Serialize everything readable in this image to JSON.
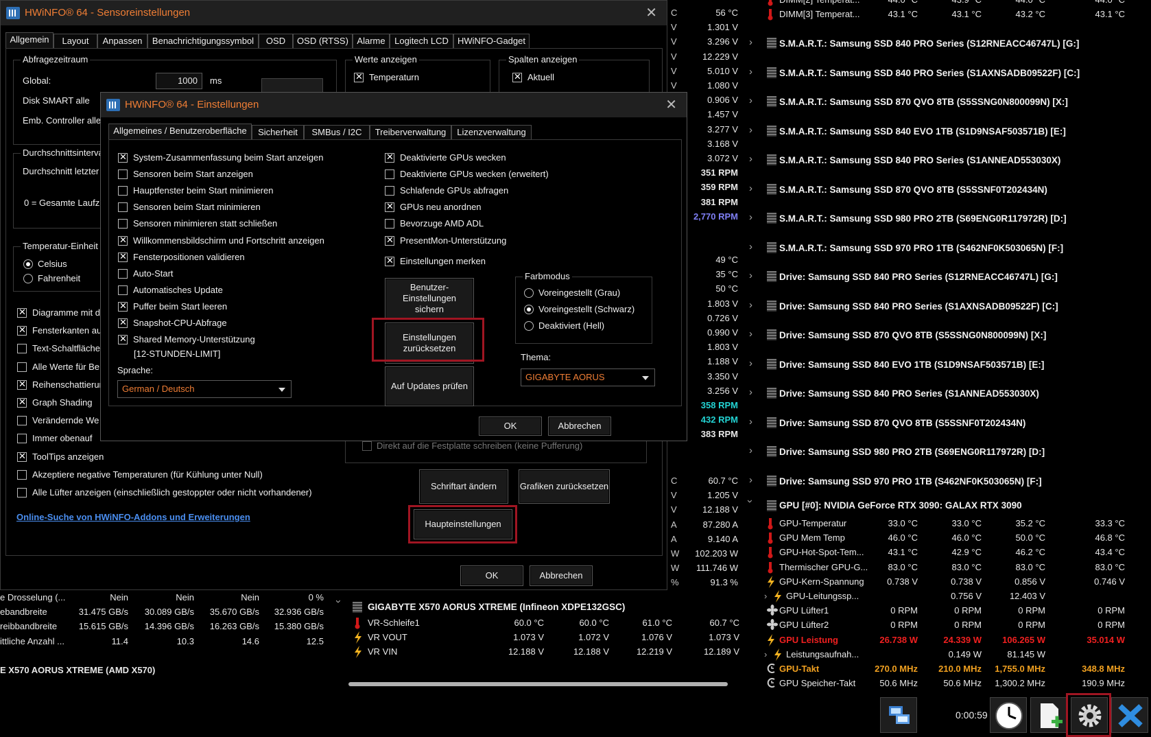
{
  "middle_values": {
    "top": [
      "56 °C",
      "1.301 V",
      "3.296 V",
      "12.229 V",
      "5.010 V",
      "1.080 V",
      "0.906 V",
      "1.457 V",
      "3.277 V",
      "3.168 V",
      "3.072 V"
    ],
    "rpm": [
      "351 RPM",
      "359 RPM",
      "381 RPM",
      "2,770 RPM"
    ],
    "temps": [
      "49 °C",
      "35 °C",
      "50 °C"
    ],
    "volts": [
      "1.803 V",
      "0.726 V",
      "0.990 V",
      "1.803 V",
      "1.188 V",
      "3.350 V",
      "3.256 V"
    ],
    "rpm2": [
      "358 RPM",
      "432 RPM",
      "383 RPM"
    ],
    "lower": [
      "60.7 °C",
      "1.205 V",
      "12.188 V",
      "87.280 A",
      "9.140 A",
      "102.203 W",
      "111.746 W",
      "91.3 %"
    ],
    "lower_units": [
      "C",
      "V",
      "V",
      "A",
      "A",
      "W",
      "W",
      "%"
    ],
    "top_units": [
      "C",
      "V",
      "V",
      "V",
      "V",
      "V",
      "V",
      "V",
      "V",
      "V",
      "V"
    ]
  },
  "right_panel": {
    "top_rows": [
      {
        "label": "DIMM[2] Temperat...",
        "v": [
          "44.0 °C",
          "43.9 °C",
          "44.0 °C",
          "44.0 °C"
        ]
      },
      {
        "label": "DIMM[3] Temperat...",
        "v": [
          "43.1 °C",
          "43.1 °C",
          "43.2 °C",
          "43.1 °C"
        ]
      }
    ],
    "devices": [
      "S.M.A.R.T.: Samsung SSD 840 PRO Series (S12RNEACC46747L) [G:]",
      "S.M.A.R.T.: Samsung SSD 840 PRO Series (S1AXNSADB09522F) [C:]",
      "S.M.A.R.T.: Samsung SSD 870 QVO 8TB (S5SSNG0N800099N) [X:]",
      "S.M.A.R.T.: Samsung SSD 840 EVO 1TB (S1D9NSAF503571B) [E:]",
      "S.M.A.R.T.: Samsung SSD 840 PRO Series (S1ANNEAD553030X)",
      "S.M.A.R.T.: Samsung SSD 870 QVO 8TB (S5SSNF0T202434N)",
      "S.M.A.R.T.: Samsung SSD 980 PRO 2TB (S69ENG0R117972R) [D:]",
      "S.M.A.R.T.: Samsung SSD 970 PRO 1TB (S462NF0K503065N) [F:]",
      "Drive: Samsung SSD 840 PRO Series (S12RNEACC46747L) [G:]",
      "Drive: Samsung SSD 840 PRO Series (S1AXNSADB09522F) [C:]",
      "Drive: Samsung SSD 870 QVO 8TB (S5SSNG0N800099N) [X:]",
      "Drive: Samsung SSD 840 EVO 1TB (S1D9NSAF503571B) [E:]",
      "Drive: Samsung SSD 840 PRO Series (S1ANNEAD553030X)",
      "Drive: Samsung SSD 870 QVO 8TB (S5SSNF0T202434N)",
      "Drive: Samsung SSD 980 PRO 2TB (S69ENG0R117972R) [D:]",
      "Drive: Samsung SSD 970 PRO 1TB (S462NF0K503065N) [F:]"
    ],
    "gpu_header": "GPU [#0]: NVIDIA GeForce RTX 3090: GALAX RTX 3090",
    "gpu_rows": [
      {
        "label": "GPU-Temperatur",
        "v": [
          "33.0 °C",
          "33.0 °C",
          "35.2 °C",
          "33.3 °C"
        ],
        "icon": "therm",
        "style": ""
      },
      {
        "label": "GPU Mem Temp",
        "v": [
          "46.0 °C",
          "46.0 °C",
          "50.0 °C",
          "46.8 °C"
        ],
        "icon": "therm",
        "style": ""
      },
      {
        "label": "GPU-Hot-Spot-Tem...",
        "v": [
          "43.1 °C",
          "42.9 °C",
          "46.2 °C",
          "43.4 °C"
        ],
        "icon": "therm",
        "style": ""
      },
      {
        "label": "Thermischer GPU-G...",
        "v": [
          "83.0 °C",
          "83.0 °C",
          "83.0 °C",
          "83.0 °C"
        ],
        "icon": "therm",
        "style": ""
      },
      {
        "label": "GPU-Kern-Spannung",
        "v": [
          "0.738 V",
          "0.738 V",
          "0.856 V",
          "0.746 V"
        ],
        "icon": "bolt",
        "style": ""
      },
      {
        "label": "GPU-Leitungssp...",
        "v": [
          "",
          "0.756 V",
          "12.403 V",
          ""
        ],
        "icon": "bolt",
        "style": "sub"
      },
      {
        "label": "GPU Lüfter1",
        "v": [
          "0 RPM",
          "0 RPM",
          "0 RPM",
          "0 RPM"
        ],
        "icon": "fan",
        "style": ""
      },
      {
        "label": "GPU Lüfter2",
        "v": [
          "0 RPM",
          "0 RPM",
          "0 RPM",
          "0 RPM"
        ],
        "icon": "fan",
        "style": ""
      },
      {
        "label": "GPU Leistung",
        "v": [
          "26.738 W",
          "24.339 W",
          "106.265 W",
          "35.014 W"
        ],
        "icon": "bolt",
        "style": "red"
      },
      {
        "label": "Leistungsaufnah...",
        "v": [
          "",
          "0.149 W",
          "81.145 W",
          ""
        ],
        "icon": "bolt",
        "style": "sub"
      },
      {
        "label": "GPU-Takt",
        "v": [
          "270.0 MHz",
          "210.0 MHz",
          "1,755.0 MHz",
          "348.8 MHz"
        ],
        "icon": "clock",
        "style": "orange"
      },
      {
        "label": "GPU Speicher-Takt",
        "v": [
          "50.6 MHz",
          "50.6 MHz",
          "1,300.2 MHz",
          "190.9 MHz"
        ],
        "icon": "clock",
        "style": ""
      }
    ]
  },
  "bottom_left": {
    "rows": [
      {
        "label": "e Drosselung (...",
        "v": [
          "Nein",
          "Nein",
          "Nein",
          "0 %"
        ]
      },
      {
        "label": "ebandbreite",
        "v": [
          "31.475 GB/s",
          "30.089 GB/s",
          "35.670 GB/s",
          "32.936 GB/s"
        ]
      },
      {
        "label": "reibbandbreite",
        "v": [
          "15.615 GB/s",
          "14.396 GB/s",
          "16.263 GB/s",
          "15.380 GB/s"
        ]
      },
      {
        "label": "ittliche Anzahl ...",
        "v": [
          "11.4",
          "10.3",
          "14.6",
          "12.5"
        ]
      }
    ],
    "header2": "E X570 AORUS XTREME (AMD X570)"
  },
  "bottom_mid": {
    "header": "GIGABYTE X570 AORUS XTREME (Infineon XDPE132GSC)",
    "rows": [
      {
        "label": "VR-Schleife1",
        "v": [
          "60.0 °C",
          "60.0 °C",
          "61.0 °C",
          "60.7 °C"
        ],
        "icon": "therm"
      },
      {
        "label": "VR VOUT",
        "v": [
          "1.073 V",
          "1.072 V",
          "1.076 V",
          "1.073 V"
        ],
        "icon": "bolt"
      },
      {
        "label": "VR VIN",
        "v": [
          "12.188 V",
          "12.188 V",
          "12.219 V",
          "12.189 V"
        ],
        "icon": "bolt"
      }
    ]
  },
  "taskbar": {
    "time": "0:00:59"
  },
  "sensor_settings": {
    "title": "HWiNFO® 64 - Sensoreinstellungen",
    "tabs": [
      "Allgemein",
      "Layout",
      "Anpassen",
      "Benachrichtigungssymbol",
      "OSD",
      "OSD (RTSS)",
      "Alarme",
      "Logitech LCD",
      "HWiNFO-Gadget"
    ],
    "poll_group": "Abfragezeitraum",
    "global_label": "Global:",
    "global_value": "1000",
    "ms": "ms",
    "disk_smart": "Disk SMART alle",
    "emb_ctrl": "Emb. Controller alle",
    "avg_group": "Durchschnittsinterva",
    "avg_label": "Durchschnitt letzter",
    "avg_note": "0 = Gesamte Laufz",
    "temp_group": "Temperatur-Einheit",
    "celsius": "Celsius",
    "fahrenheit": "Fahrenheit",
    "values_group": "Werte anzeigen",
    "temp_cb": "Temperaturn",
    "cols_group": "Spalten anzeigen",
    "current_cb": "Aktuell",
    "options": [
      {
        "label": "Diagramme mit d",
        "on": true
      },
      {
        "label": "Fensterkanten au",
        "on": true
      },
      {
        "label": "Text-Schaltfläche",
        "on": false
      },
      {
        "label": "Alle Werte für Be",
        "on": false
      },
      {
        "label": "Reihenschattierun",
        "on": true
      },
      {
        "label": "Graph Shading",
        "on": true
      },
      {
        "label": "Verändernde We",
        "on": false
      },
      {
        "label": "Immer obenauf",
        "on": false
      },
      {
        "label": "ToolTips anzeigen",
        "on": true
      },
      {
        "label": "Akzeptiere negative Temperaturen (für Kühlung unter Null)",
        "on": false
      },
      {
        "label": "Alle Lüfter anzeigen (einschließlich gestoppter oder nicht vorhandener)",
        "on": false
      }
    ],
    "direct_write": "Direkt auf die Festplatte schreiben (keine Pufferung)",
    "link": "Online-Suche von HWiNFO-Addons und Erweiterungen",
    "font_btn": "Schriftart ändern",
    "reset_gfx_btn": "Grafiken zurücksetzen",
    "main_settings_btn": "Haupteinstellungen",
    "ok": "OK",
    "cancel": "Abbrechen"
  },
  "settings": {
    "title": "HWiNFO® 64 - Einstellungen",
    "tabs": [
      "Allgemeines / Benutzeroberfläche",
      "Sicherheit",
      "SMBus / I2C",
      "Treiberverwaltung",
      "Lizenzverwaltung"
    ],
    "left_options": [
      {
        "label": "System-Zusammenfassung beim Start anzeigen",
        "on": true
      },
      {
        "label": "Sensoren beim Start anzeigen",
        "on": false
      },
      {
        "label": "Hauptfenster beim Start minimieren",
        "on": false
      },
      {
        "label": "Sensoren beim Start minimieren",
        "on": false
      },
      {
        "label": "Sensoren minimieren statt schließen",
        "on": false
      },
      {
        "label": "Willkommensbildschirm und Fortschritt anzeigen",
        "on": true
      },
      {
        "label": "Fensterpositionen validieren",
        "on": true
      },
      {
        "label": "Auto-Start",
        "on": false
      },
      {
        "label": "Automatisches Update",
        "on": false
      },
      {
        "label": "Puffer beim Start leeren",
        "on": true
      },
      {
        "label": "Snapshot-CPU-Abfrage",
        "on": true
      },
      {
        "label": "Shared Memory-Unterstützung",
        "on": true
      }
    ],
    "shm_limit": "[12-STUNDEN-LIMIT]",
    "right_options": [
      {
        "label": "Deaktivierte GPUs wecken",
        "on": true
      },
      {
        "label": "Deaktivierte GPUs wecken (erweitert)",
        "on": false
      },
      {
        "label": "Schlafende GPUs abfragen",
        "on": false
      },
      {
        "label": "GPUs neu anordnen",
        "on": true
      },
      {
        "label": "Bevorzuge AMD ADL",
        "on": false
      },
      {
        "label": "PresentMon-Unterstützung",
        "on": true
      }
    ],
    "remember": "Einstellungen merken",
    "save_user_btn": "Benutzer-Einstellungen sichern",
    "reset_btn": "Einstellungen zurücksetzen",
    "update_btn": "Auf Updates prüfen",
    "lang_label": "Sprache:",
    "lang_value": "German / Deutsch",
    "color_group": "Farbmodus",
    "color_opts": [
      {
        "label": "Voreingestellt (Grau)",
        "on": false
      },
      {
        "label": "Voreingestellt (Schwarz)",
        "on": true
      },
      {
        "label": "Deaktiviert (Hell)",
        "on": false
      }
    ],
    "theme_label": "Thema:",
    "theme_value": "GIGABYTE AORUS",
    "ok": "OK",
    "cancel": "Abbrechen"
  }
}
